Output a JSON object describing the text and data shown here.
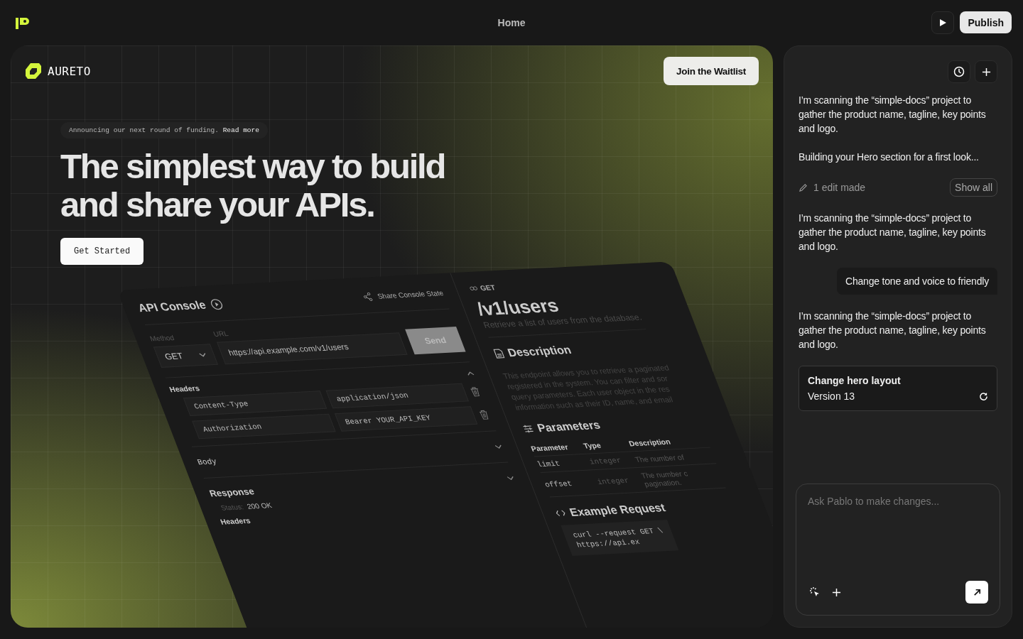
{
  "topbar": {
    "page": "Home",
    "publish": "Publish"
  },
  "preview": {
    "brand": "AURETO",
    "cta": "Join the Waitlist",
    "announcement": {
      "text": "Announcing our next round of funding.",
      "link": "Read more"
    },
    "headline": [
      "The simplest way to build",
      "and share your APIs."
    ],
    "get_started": "Get Started",
    "console": {
      "title": "API Console",
      "share": "Share Console State",
      "method_label": "Method",
      "url_label": "URL",
      "method": "GET",
      "url": "https://api.example.com/v1/users",
      "send": "Send",
      "headers_label": "Headers",
      "headers": [
        {
          "key": "Content-Type",
          "value": "application/json"
        },
        {
          "key": "Authorization",
          "value": "Bearer YOUR_API_KEY"
        }
      ],
      "body_label": "Body",
      "response_title": "Response",
      "status_label": "Status:",
      "status": "200 OK",
      "response_headers_label": "Headers"
    },
    "docs": {
      "method": "GET",
      "path": "/v1/users",
      "summary": "Retrieve a list of users from the database.",
      "description_title": "Description",
      "description": [
        "This endpoint allows you to retrieve a paginated",
        "registered in the system. You can filter and sor",
        "query parameters. Each user object in the res",
        "information such as their ID, name, and email"
      ],
      "parameters_title": "Parameters",
      "columns": [
        "Parameter",
        "Type",
        "Description"
      ],
      "parameters": [
        {
          "name": "limit",
          "type": "integer",
          "description": [
            "The number of"
          ]
        },
        {
          "name": "offset",
          "type": "integer",
          "description": [
            "The number c",
            "pagination."
          ]
        }
      ],
      "example_title": "Example Request",
      "code": [
        "curl --request GET \\",
        "https://api.ex"
      ]
    }
  },
  "chat": {
    "messages": [
      {
        "kind": "assistant",
        "text": "I’m scanning the “simple-docs” project to gather the product name, tagline, key points and logo."
      },
      {
        "kind": "assistant",
        "text": "Building your Hero section for a first look..."
      },
      {
        "kind": "edits",
        "text": "1 edit made",
        "action": "Show all"
      },
      {
        "kind": "assistant",
        "text": "I’m scanning the “simple-docs” project to gather the product name, tagline, key points and logo."
      },
      {
        "kind": "user",
        "text": "Change tone and voice to friendly"
      },
      {
        "kind": "assistant",
        "text": "I’m scanning the “simple-docs” project to gather the product name, tagline, key points and logo."
      },
      {
        "kind": "version",
        "title": "Change hero layout",
        "subtitle": "Version 13"
      }
    ],
    "placeholder": "Ask Pablo to make changes..."
  }
}
